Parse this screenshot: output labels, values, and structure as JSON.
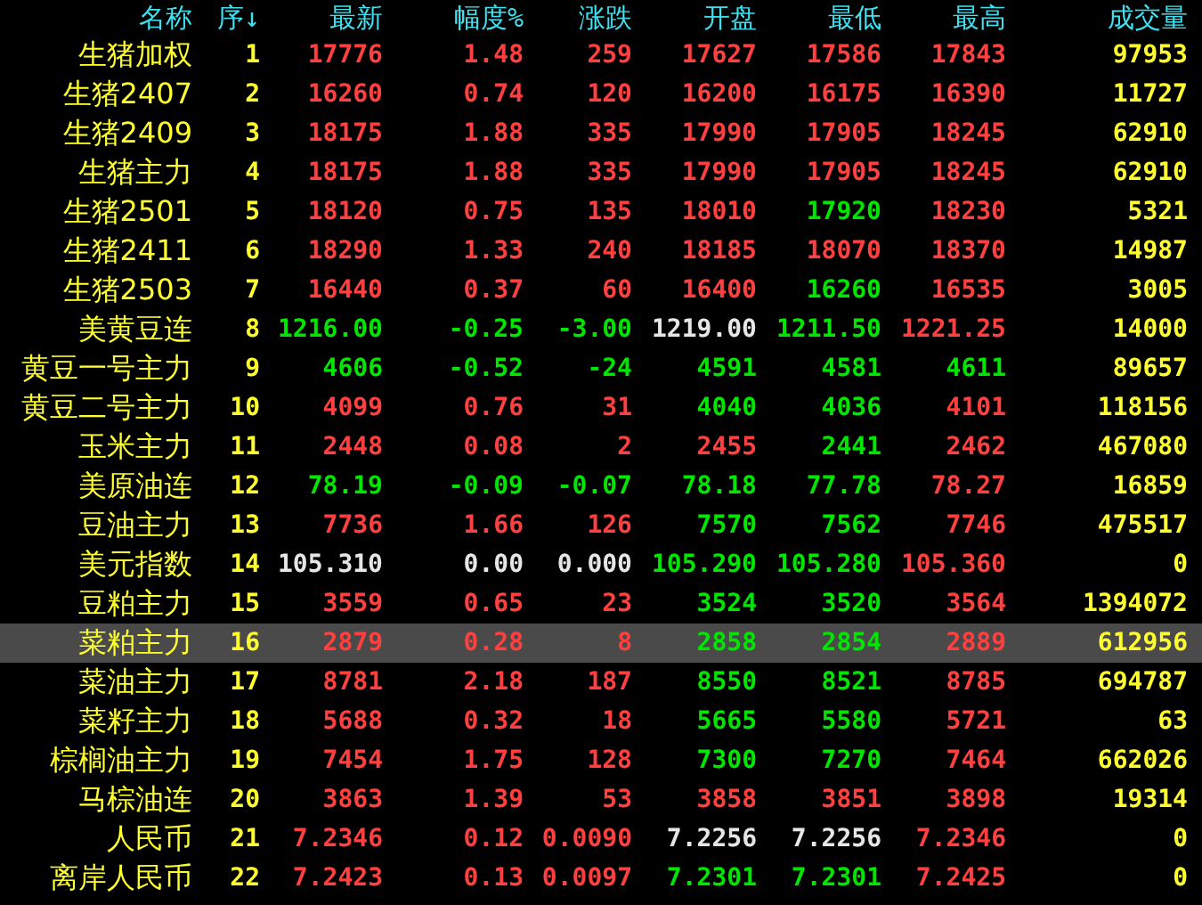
{
  "columns": [
    "名称",
    "序↓",
    "最新",
    "幅度%",
    "涨跌",
    "开盘",
    "最低",
    "最高",
    "成交量"
  ],
  "rows": [
    {
      "name": "生猪加权",
      "index": "1",
      "selected": false,
      "cells": [
        {
          "text": "17776",
          "color": "#ff4040"
        },
        {
          "text": "1.48",
          "color": "#ff4040"
        },
        {
          "text": "259",
          "color": "#ff4040"
        },
        {
          "text": "17627",
          "color": "#ff4040"
        },
        {
          "text": "17586",
          "color": "#ff4040"
        },
        {
          "text": "17843",
          "color": "#ff4040"
        }
      ],
      "volume": "97953"
    },
    {
      "name": "生猪2407",
      "index": "2",
      "selected": false,
      "cells": [
        {
          "text": "16260",
          "color": "#ff4040"
        },
        {
          "text": "0.74",
          "color": "#ff4040"
        },
        {
          "text": "120",
          "color": "#ff4040"
        },
        {
          "text": "16200",
          "color": "#ff4040"
        },
        {
          "text": "16175",
          "color": "#ff4040"
        },
        {
          "text": "16390",
          "color": "#ff4040"
        }
      ],
      "volume": "11727"
    },
    {
      "name": "生猪2409",
      "index": "3",
      "selected": false,
      "cells": [
        {
          "text": "18175",
          "color": "#ff4040"
        },
        {
          "text": "1.88",
          "color": "#ff4040"
        },
        {
          "text": "335",
          "color": "#ff4040"
        },
        {
          "text": "17990",
          "color": "#ff4040"
        },
        {
          "text": "17905",
          "color": "#ff4040"
        },
        {
          "text": "18245",
          "color": "#ff4040"
        }
      ],
      "volume": "62910"
    },
    {
      "name": "生猪主力",
      "index": "4",
      "selected": false,
      "cells": [
        {
          "text": "18175",
          "color": "#ff4040"
        },
        {
          "text": "1.88",
          "color": "#ff4040"
        },
        {
          "text": "335",
          "color": "#ff4040"
        },
        {
          "text": "17990",
          "color": "#ff4040"
        },
        {
          "text": "17905",
          "color": "#ff4040"
        },
        {
          "text": "18245",
          "color": "#ff4040"
        }
      ],
      "volume": "62910"
    },
    {
      "name": "生猪2501",
      "index": "5",
      "selected": false,
      "cells": [
        {
          "text": "18120",
          "color": "#ff4040"
        },
        {
          "text": "0.75",
          "color": "#ff4040"
        },
        {
          "text": "135",
          "color": "#ff4040"
        },
        {
          "text": "18010",
          "color": "#ff4040"
        },
        {
          "text": "17920",
          "color": "#00e600"
        },
        {
          "text": "18230",
          "color": "#ff4040"
        }
      ],
      "volume": "5321"
    },
    {
      "name": "生猪2411",
      "index": "6",
      "selected": false,
      "cells": [
        {
          "text": "18290",
          "color": "#ff4040"
        },
        {
          "text": "1.33",
          "color": "#ff4040"
        },
        {
          "text": "240",
          "color": "#ff4040"
        },
        {
          "text": "18185",
          "color": "#ff4040"
        },
        {
          "text": "18070",
          "color": "#ff4040"
        },
        {
          "text": "18370",
          "color": "#ff4040"
        }
      ],
      "volume": "14987"
    },
    {
      "name": "生猪2503",
      "index": "7",
      "selected": false,
      "cells": [
        {
          "text": "16440",
          "color": "#ff4040"
        },
        {
          "text": "0.37",
          "color": "#ff4040"
        },
        {
          "text": "60",
          "color": "#ff4040"
        },
        {
          "text": "16400",
          "color": "#ff4040"
        },
        {
          "text": "16260",
          "color": "#00e600"
        },
        {
          "text": "16535",
          "color": "#ff4040"
        }
      ],
      "volume": "3005"
    },
    {
      "name": "美黄豆连",
      "index": "8",
      "selected": false,
      "cells": [
        {
          "text": "1216.00",
          "color": "#00e600"
        },
        {
          "text": "-0.25",
          "color": "#00e600"
        },
        {
          "text": "-3.00",
          "color": "#00e600"
        },
        {
          "text": "1219.00",
          "color": "#e6e6e6"
        },
        {
          "text": "1211.50",
          "color": "#00e600"
        },
        {
          "text": "1221.25",
          "color": "#ff4040"
        }
      ],
      "volume": "14000"
    },
    {
      "name": "黄豆一号主力",
      "index": "9",
      "selected": false,
      "cells": [
        {
          "text": "4606",
          "color": "#00e600"
        },
        {
          "text": "-0.52",
          "color": "#00e600"
        },
        {
          "text": "-24",
          "color": "#00e600"
        },
        {
          "text": "4591",
          "color": "#00e600"
        },
        {
          "text": "4581",
          "color": "#00e600"
        },
        {
          "text": "4611",
          "color": "#00e600"
        }
      ],
      "volume": "89657"
    },
    {
      "name": "黄豆二号主力",
      "index": "10",
      "selected": false,
      "cells": [
        {
          "text": "4099",
          "color": "#ff4040"
        },
        {
          "text": "0.76",
          "color": "#ff4040"
        },
        {
          "text": "31",
          "color": "#ff4040"
        },
        {
          "text": "4040",
          "color": "#00e600"
        },
        {
          "text": "4036",
          "color": "#00e600"
        },
        {
          "text": "4101",
          "color": "#ff4040"
        }
      ],
      "volume": "118156"
    },
    {
      "name": "玉米主力",
      "index": "11",
      "selected": false,
      "cells": [
        {
          "text": "2448",
          "color": "#ff4040"
        },
        {
          "text": "0.08",
          "color": "#ff4040"
        },
        {
          "text": "2",
          "color": "#ff4040"
        },
        {
          "text": "2455",
          "color": "#ff4040"
        },
        {
          "text": "2441",
          "color": "#00e600"
        },
        {
          "text": "2462",
          "color": "#ff4040"
        }
      ],
      "volume": "467080"
    },
    {
      "name": "美原油连",
      "index": "12",
      "selected": false,
      "cells": [
        {
          "text": "78.19",
          "color": "#00e600"
        },
        {
          "text": "-0.09",
          "color": "#00e600"
        },
        {
          "text": "-0.07",
          "color": "#00e600"
        },
        {
          "text": "78.18",
          "color": "#00e600"
        },
        {
          "text": "77.78",
          "color": "#00e600"
        },
        {
          "text": "78.27",
          "color": "#ff4040"
        }
      ],
      "volume": "16859"
    },
    {
      "name": "豆油主力",
      "index": "13",
      "selected": false,
      "cells": [
        {
          "text": "7736",
          "color": "#ff4040"
        },
        {
          "text": "1.66",
          "color": "#ff4040"
        },
        {
          "text": "126",
          "color": "#ff4040"
        },
        {
          "text": "7570",
          "color": "#00e600"
        },
        {
          "text": "7562",
          "color": "#00e600"
        },
        {
          "text": "7746",
          "color": "#ff4040"
        }
      ],
      "volume": "475517"
    },
    {
      "name": "美元指数",
      "index": "14",
      "selected": false,
      "cells": [
        {
          "text": "105.310",
          "color": "#e6e6e6"
        },
        {
          "text": "0.00",
          "color": "#e6e6e6"
        },
        {
          "text": "0.000",
          "color": "#e6e6e6"
        },
        {
          "text": "105.290",
          "color": "#00e600"
        },
        {
          "text": "105.280",
          "color": "#00e600"
        },
        {
          "text": "105.360",
          "color": "#ff4040"
        }
      ],
      "volume": "0"
    },
    {
      "name": "豆粕主力",
      "index": "15",
      "selected": false,
      "cells": [
        {
          "text": "3559",
          "color": "#ff4040"
        },
        {
          "text": "0.65",
          "color": "#ff4040"
        },
        {
          "text": "23",
          "color": "#ff4040"
        },
        {
          "text": "3524",
          "color": "#00e600"
        },
        {
          "text": "3520",
          "color": "#00e600"
        },
        {
          "text": "3564",
          "color": "#ff4040"
        }
      ],
      "volume": "1394072"
    },
    {
      "name": "菜粕主力",
      "index": "16",
      "selected": true,
      "cells": [
        {
          "text": "2879",
          "color": "#ff4040"
        },
        {
          "text": "0.28",
          "color": "#ff4040"
        },
        {
          "text": "8",
          "color": "#ff4040"
        },
        {
          "text": "2858",
          "color": "#00e600"
        },
        {
          "text": "2854",
          "color": "#00e600"
        },
        {
          "text": "2889",
          "color": "#ff4040"
        }
      ],
      "volume": "612956"
    },
    {
      "name": "菜油主力",
      "index": "17",
      "selected": false,
      "cells": [
        {
          "text": "8781",
          "color": "#ff4040"
        },
        {
          "text": "2.18",
          "color": "#ff4040"
        },
        {
          "text": "187",
          "color": "#ff4040"
        },
        {
          "text": "8550",
          "color": "#00e600"
        },
        {
          "text": "8521",
          "color": "#00e600"
        },
        {
          "text": "8785",
          "color": "#ff4040"
        }
      ],
      "volume": "694787"
    },
    {
      "name": "菜籽主力",
      "index": "18",
      "selected": false,
      "cells": [
        {
          "text": "5688",
          "color": "#ff4040"
        },
        {
          "text": "0.32",
          "color": "#ff4040"
        },
        {
          "text": "18",
          "color": "#ff4040"
        },
        {
          "text": "5665",
          "color": "#00e600"
        },
        {
          "text": "5580",
          "color": "#00e600"
        },
        {
          "text": "5721",
          "color": "#ff4040"
        }
      ],
      "volume": "63"
    },
    {
      "name": "棕榈油主力",
      "index": "19",
      "selected": false,
      "cells": [
        {
          "text": "7454",
          "color": "#ff4040"
        },
        {
          "text": "1.75",
          "color": "#ff4040"
        },
        {
          "text": "128",
          "color": "#ff4040"
        },
        {
          "text": "7300",
          "color": "#00e600"
        },
        {
          "text": "7270",
          "color": "#00e600"
        },
        {
          "text": "7464",
          "color": "#ff4040"
        }
      ],
      "volume": "662026"
    },
    {
      "name": "马棕油连",
      "index": "20",
      "selected": false,
      "cells": [
        {
          "text": "3863",
          "color": "#ff4040"
        },
        {
          "text": "1.39",
          "color": "#ff4040"
        },
        {
          "text": "53",
          "color": "#ff4040"
        },
        {
          "text": "3858",
          "color": "#ff4040"
        },
        {
          "text": "3851",
          "color": "#ff4040"
        },
        {
          "text": "3898",
          "color": "#ff4040"
        }
      ],
      "volume": "19314"
    },
    {
      "name": "人民币",
      "index": "21",
      "selected": false,
      "cells": [
        {
          "text": "7.2346",
          "color": "#ff4040"
        },
        {
          "text": "0.12",
          "color": "#ff4040"
        },
        {
          "text": "0.0090",
          "color": "#ff4040"
        },
        {
          "text": "7.2256",
          "color": "#e6e6e6"
        },
        {
          "text": "7.2256",
          "color": "#e6e6e6"
        },
        {
          "text": "7.2346",
          "color": "#ff4040"
        }
      ],
      "volume": "0"
    },
    {
      "name": "离岸人民币",
      "index": "22",
      "selected": false,
      "cells": [
        {
          "text": "7.2423",
          "color": "#ff4040"
        },
        {
          "text": "0.13",
          "color": "#ff4040"
        },
        {
          "text": "0.0097",
          "color": "#ff4040"
        },
        {
          "text": "7.2301",
          "color": "#00e600"
        },
        {
          "text": "7.2301",
          "color": "#00e600"
        },
        {
          "text": "7.2425",
          "color": "#ff4040"
        }
      ],
      "volume": "0"
    }
  ]
}
